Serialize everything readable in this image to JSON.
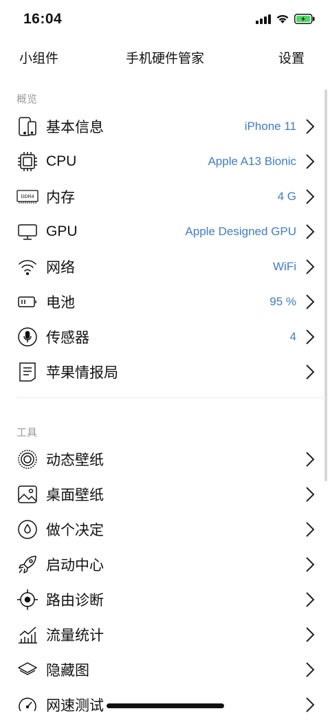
{
  "status": {
    "time": "16:04"
  },
  "nav": {
    "left": "小组件",
    "title": "手机硬件管家",
    "right": "设置"
  },
  "sections": {
    "overview": {
      "title": "概览"
    },
    "tools": {
      "title": "工具"
    }
  },
  "overview_items": [
    {
      "icon": "phone-icon",
      "label": "基本信息",
      "value": "iPhone 11"
    },
    {
      "icon": "cpu-chip-icon",
      "label": "CPU",
      "value": "Apple A13 Bionic"
    },
    {
      "icon": "ram-icon",
      "label": "内存",
      "value": "4 G",
      "icon_text": "DDR4"
    },
    {
      "icon": "monitor-icon",
      "label": "GPU",
      "value": "Apple Designed GPU"
    },
    {
      "icon": "wifi-icon",
      "label": "网络",
      "value": "WiFi"
    },
    {
      "icon": "battery-icon",
      "label": "电池",
      "value": "95 %"
    },
    {
      "icon": "microphone-icon",
      "label": "传感器",
      "value": "4"
    },
    {
      "icon": "news-icon",
      "label": "苹果情报局",
      "value": ""
    }
  ],
  "tool_items": [
    {
      "icon": "live-wallpaper-icon",
      "label": "动态壁纸"
    },
    {
      "icon": "photo-icon",
      "label": "桌面壁纸"
    },
    {
      "icon": "decision-icon",
      "label": "做个决定"
    },
    {
      "icon": "rocket-icon",
      "label": "启动中心"
    },
    {
      "icon": "crosshair-icon",
      "label": "路由诊断"
    },
    {
      "icon": "chart-icon",
      "label": "流量统计"
    },
    {
      "icon": "layers-icon",
      "label": "隐藏图"
    },
    {
      "icon": "speedometer-icon",
      "label": "网速测试"
    }
  ],
  "colors": {
    "accent": "#3d7bd6",
    "battery": "#4cd964",
    "header": "#9a9a9a"
  }
}
